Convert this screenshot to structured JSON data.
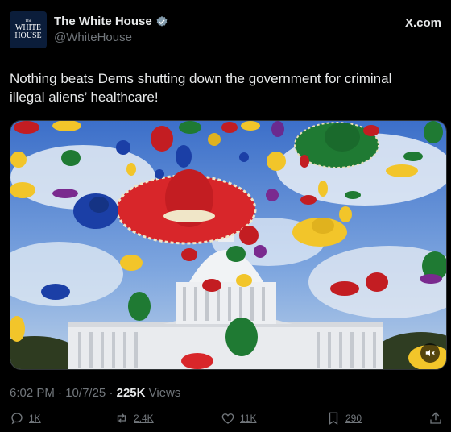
{
  "account": {
    "avatar_lines": [
      "The",
      "WHITE",
      "HOUSE"
    ],
    "display_name": "The White House",
    "handle": "@WhiteHouse",
    "verified_color": "#829aab"
  },
  "site_label": "X.com",
  "tweet_text": "Nothing beats Dems shutting down the government for criminal illegal aliens’ healthcare!",
  "media": {
    "type": "video",
    "icons": [
      "mute-icon"
    ]
  },
  "meta": {
    "time": "6:02 PM",
    "date": "10/7/25",
    "views_count": "225K",
    "views_label": "Views"
  },
  "actions": {
    "reply": "1K",
    "retweet": "2.4K",
    "like": "11K",
    "bookmark": "290"
  },
  "colors": {
    "background": "#000000",
    "text": "#e7e9ea",
    "muted": "#71767b"
  }
}
